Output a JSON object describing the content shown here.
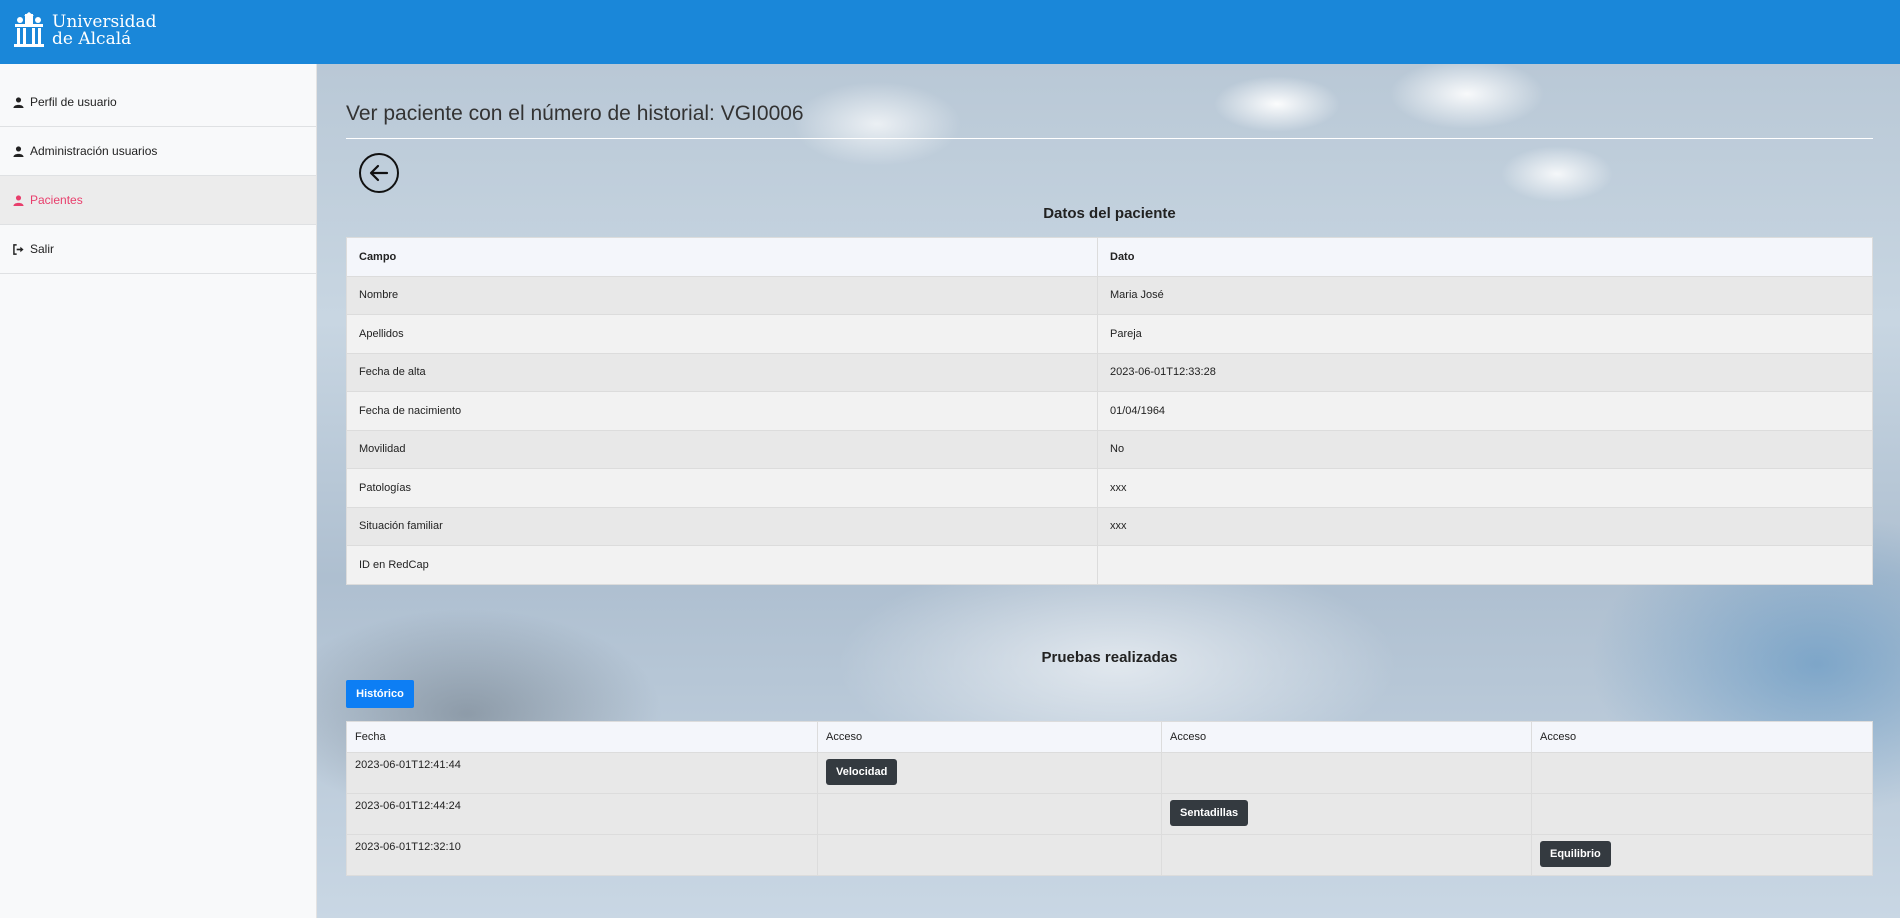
{
  "header": {
    "logo_line1": "Universidad",
    "logo_line2": "de Alcalá",
    "brand_color": "#1a87d9"
  },
  "sidebar": {
    "items": [
      {
        "label": "Perfil de usuario",
        "icon": "user-icon",
        "active": false
      },
      {
        "label": "Administración usuarios",
        "icon": "user-icon",
        "active": false
      },
      {
        "label": "Pacientes",
        "icon": "user-icon",
        "active": true
      },
      {
        "label": "Salir",
        "icon": "sign-out-icon",
        "active": false
      }
    ],
    "active_color": "#e83e6c"
  },
  "main": {
    "title": "Ver paciente con el número de historial: VGI0006",
    "patient_section_title": "Datos del paciente",
    "patient_table": {
      "headers": [
        "Campo",
        "Dato"
      ],
      "rows": [
        [
          "Nombre",
          "Maria José"
        ],
        [
          "Apellidos",
          "Pareja"
        ],
        [
          "Fecha de alta",
          "2023-06-01T12:33:28"
        ],
        [
          "Fecha de nacimiento",
          "01/04/1964"
        ],
        [
          "Movilidad",
          "No"
        ],
        [
          "Patologías",
          "xxx"
        ],
        [
          "Situación familiar",
          "xxx"
        ],
        [
          "ID en RedCap",
          ""
        ]
      ]
    },
    "tests_section_title": "Pruebas realizadas",
    "historico_button": "Histórico",
    "tests_table": {
      "headers": [
        "Fecha",
        "Acceso",
        "Acceso",
        "Acceso"
      ],
      "rows": [
        {
          "date": "2023-06-01T12:41:44",
          "buttons": [
            "Velocidad",
            "",
            ""
          ]
        },
        {
          "date": "2023-06-01T12:44:24",
          "buttons": [
            "",
            "Sentadillas",
            ""
          ]
        },
        {
          "date": "2023-06-01T12:32:10",
          "buttons": [
            "",
            "",
            "Equilibrio"
          ]
        }
      ]
    }
  }
}
